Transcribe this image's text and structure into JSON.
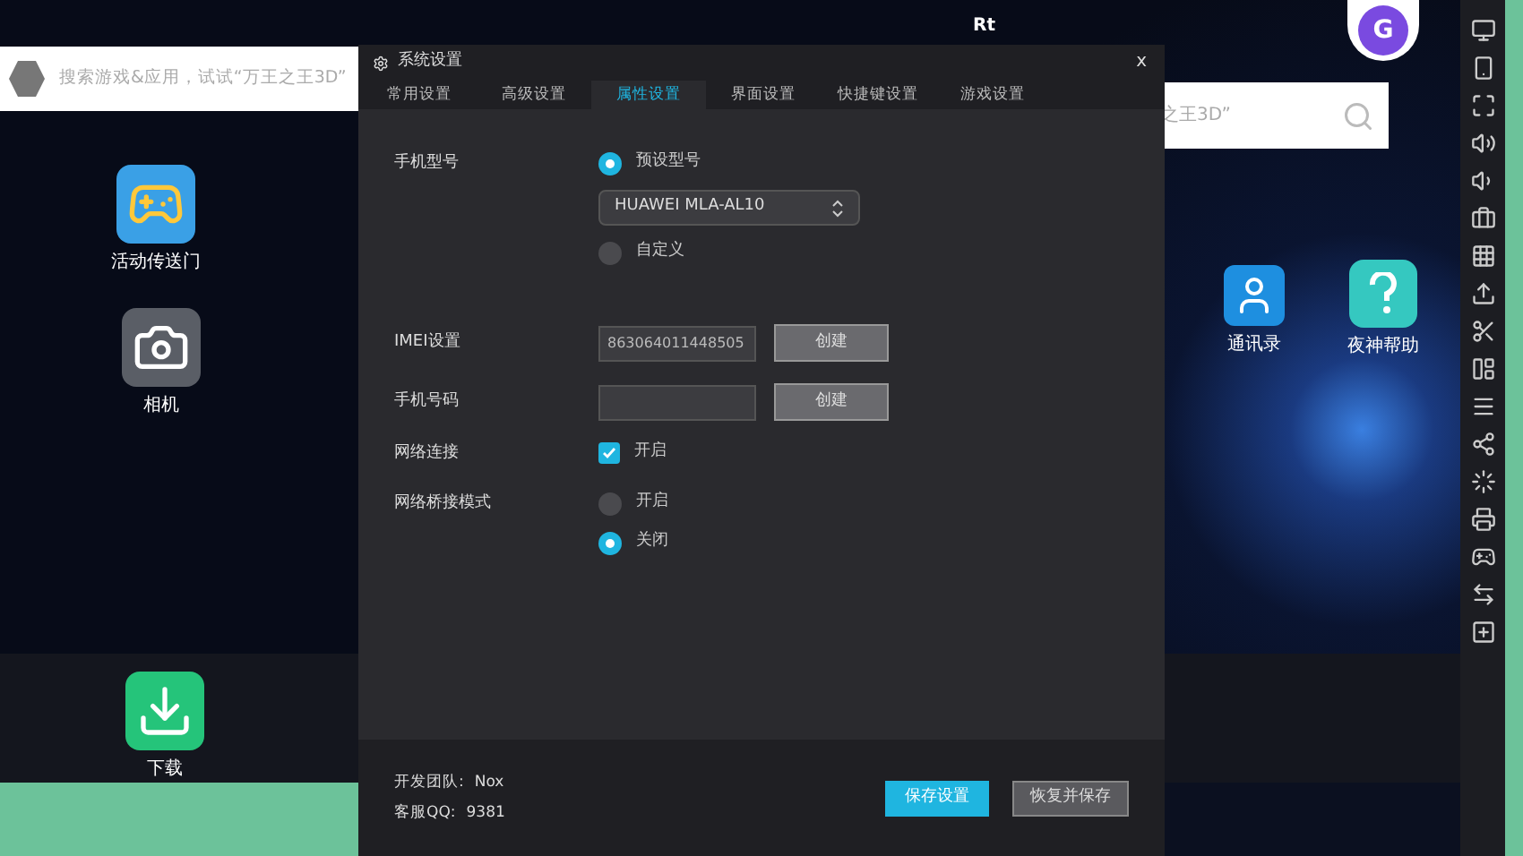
{
  "emulator": {
    "top_label": "Rt",
    "corner_app": {
      "text": "G"
    },
    "search_left": {
      "placeholder": "搜索游戏&应用，试试“万王之王3D”"
    },
    "search_right": {
      "placeholder": "之王3D”"
    },
    "apps": [
      {
        "label": "活动传送门",
        "kind": "gamepad"
      },
      {
        "label": "相机",
        "kind": "camera"
      },
      {
        "label": "下载",
        "kind": "download"
      },
      {
        "label": "通讯录",
        "kind": "contacts"
      },
      {
        "label": "夜神帮助",
        "kind": "help"
      }
    ]
  },
  "dialog": {
    "title": "系统设置",
    "close": "x",
    "tabs": [
      {
        "label": "常用设置",
        "selected": false
      },
      {
        "label": "高级设置",
        "selected": false
      },
      {
        "label": "属性设置",
        "selected": true
      },
      {
        "label": "界面设置",
        "selected": false
      },
      {
        "label": "快捷键设置",
        "selected": false
      },
      {
        "label": "游戏设置",
        "selected": false
      }
    ],
    "rows": [
      {
        "label": "手机型号",
        "controls": [
          {
            "kind": "radio",
            "text": "预设型号",
            "selected": true
          },
          {
            "kind": "select",
            "value": "HUAWEI MLA-AL10"
          },
          {
            "kind": "radio",
            "text": "自定义",
            "selected": false
          }
        ]
      },
      {
        "label": "IMEI设置",
        "controls": [
          {
            "kind": "field",
            "value": "863064011448505",
            "button": "创建"
          }
        ]
      },
      {
        "label": "手机号码",
        "controls": [
          {
            "kind": "field",
            "button": "创建"
          }
        ]
      },
      {
        "label": "网络连接",
        "controls": [
          {
            "kind": "checkbox",
            "text": "开启",
            "checked": true
          }
        ]
      },
      {
        "label": "网络桥接模式",
        "controls": [
          {
            "kind": "radio",
            "text": "开启",
            "selected": false
          },
          {
            "kind": "radio",
            "text": "关闭",
            "selected": true
          }
        ]
      }
    ],
    "footer": {
      "team_label": "开发团队:",
      "team": "Nox",
      "qq_label": "客服QQ:",
      "qq": "9381",
      "buttons": [
        {
          "label": "保存设置",
          "kind": "primary"
        },
        {
          "label": "恢复并保存",
          "kind": "secondary"
        }
      ]
    }
  }
}
